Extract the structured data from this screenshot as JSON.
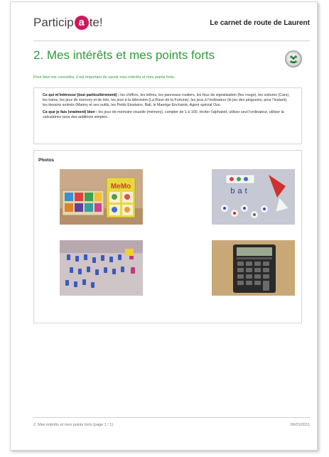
{
  "header": {
    "logo_prefix": "Particip",
    "logo_circle": "a",
    "logo_suffix": "te!",
    "carnet_title": "Le carnet de route de Laurent"
  },
  "section": {
    "title": "2. Mes intérêts et mes points forts",
    "badge_icon": "people-icon",
    "intro": "Pour bien me connaître, il est important de savoir mes intérêts et mes points forts."
  },
  "interests": {
    "label": "Ce qui m'intéresse (tout particulièrement) :",
    "text": "les chiffres, les lettres, les panneaux routiers, les feux de signalisation (feu rouge), les voitures (Cars), les trains, les jeux de memory et de loto, les jeux à la télévision (La Roue de la Fortune), les jeux à l'ordinateur (le jeu des pingouins, pour l'instant), les dessins animés (Manny et ses outils, les Petits Einsteins, Bali, le Manège Enchanté, Agent spécial Oso."
  },
  "strengths": {
    "label": "Ce que je fais (vraiment) bien :",
    "text": "les jeux de mémoire visuelle (mémory), compter de 1 à 100, réciter l'alphabet, utiliser seul l'ordinateur, utiliser la calculatrice pour des additions simples."
  },
  "photos": {
    "label": "Photos",
    "logo_text": "MeMo",
    "card_text": "bat"
  },
  "footer": {
    "left": "2. Mes intérêts et mes points forts (page 1 / 1)",
    "right": "06/01/2011"
  }
}
